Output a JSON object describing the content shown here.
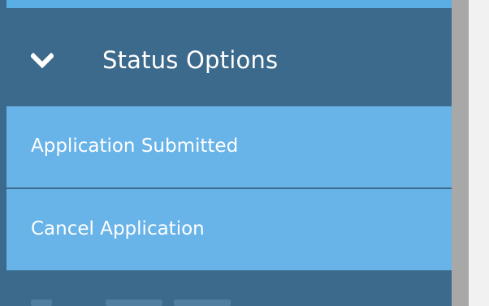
{
  "sidebar": {
    "section_header": {
      "label": "Status Options",
      "icon": "chevron-down-icon",
      "expanded": true
    },
    "items": [
      {
        "label": "Application Submitted"
      },
      {
        "label": "Cancel Application"
      }
    ]
  },
  "colors": {
    "header_bg": "#3c6a8c",
    "item_bg": "#68b3e8",
    "text": "#ffffff",
    "scrollbar": "#a3a3a3",
    "page_bg": "#f1f1f1"
  }
}
